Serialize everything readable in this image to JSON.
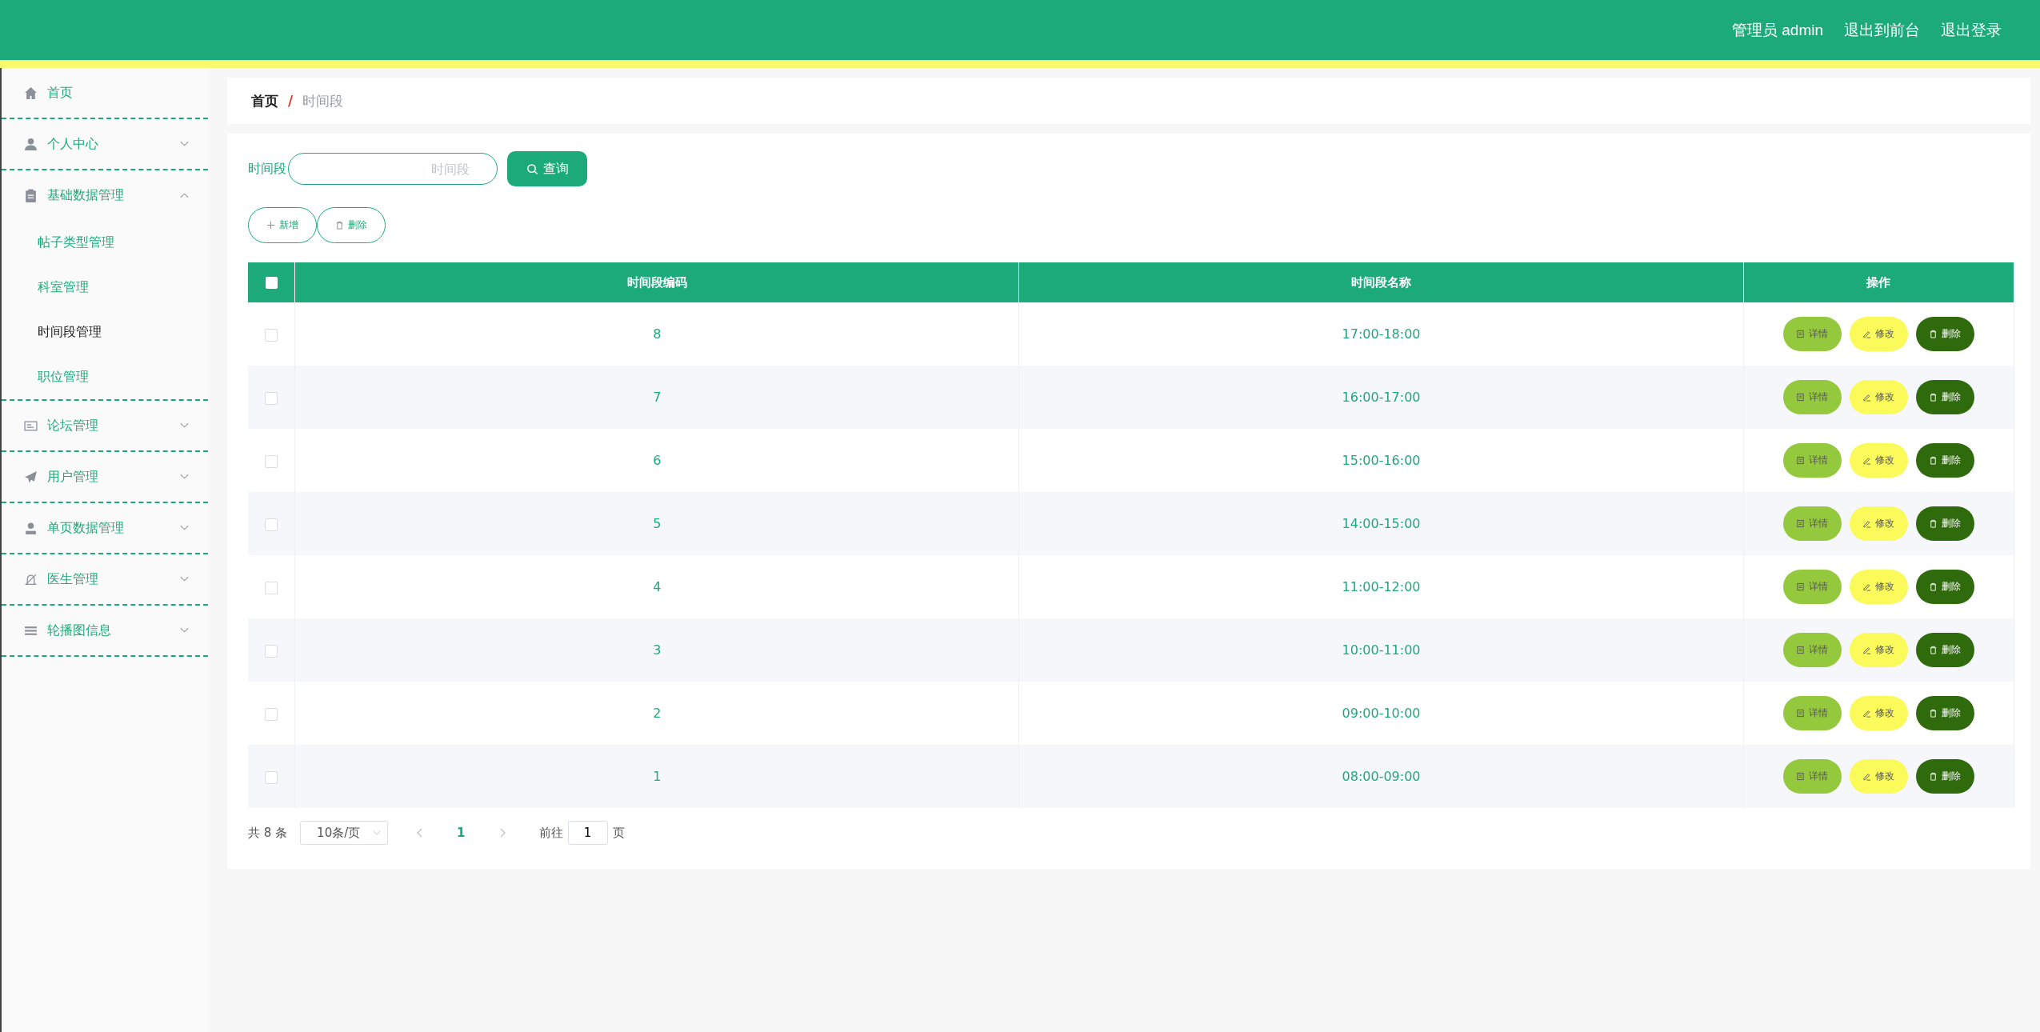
{
  "header": {
    "user_links": [
      "管理员 admin",
      "退出到前台",
      "退出登录"
    ]
  },
  "sidebar": {
    "items": [
      {
        "label": "首页",
        "kind": "link"
      },
      {
        "label": "个人中心",
        "kind": "menu",
        "expanded": false
      },
      {
        "label": "基础数据管理",
        "kind": "menu",
        "expanded": true,
        "children": [
          {
            "label": "帖子类型管理",
            "selected": false
          },
          {
            "label": "科室管理",
            "selected": false
          },
          {
            "label": "时间段管理",
            "selected": true
          },
          {
            "label": "职位管理",
            "selected": false
          }
        ]
      },
      {
        "label": "论坛管理",
        "kind": "menu",
        "expanded": false
      },
      {
        "label": "用户管理",
        "kind": "menu",
        "expanded": false
      },
      {
        "label": "单页数据管理",
        "kind": "menu",
        "expanded": false
      },
      {
        "label": "医生管理",
        "kind": "menu",
        "expanded": false
      },
      {
        "label": "轮播图信息",
        "kind": "menu",
        "expanded": false
      }
    ]
  },
  "breadcrumb": {
    "home": "首页",
    "separator": "/",
    "current": "时间段"
  },
  "search": {
    "label": "时间段",
    "placeholder": "时间段",
    "button": "查询"
  },
  "toolbar": [
    {
      "label": "新增",
      "kind": "add"
    },
    {
      "label": "删除",
      "kind": "delete"
    }
  ],
  "table": {
    "select_all_checked": false,
    "columns": [
      "时间段编码",
      "时间段名称",
      "操作"
    ],
    "rows": [
      {
        "checked": false,
        "code": "8",
        "name": "17:00-18:00",
        "actions": [
          {
            "label": "详情",
            "kind": "detail"
          },
          {
            "label": "修改",
            "kind": "edit"
          },
          {
            "label": "删除",
            "kind": "delete"
          }
        ]
      },
      {
        "checked": false,
        "code": "7",
        "name": "16:00-17:00",
        "actions": [
          {
            "label": "详情",
            "kind": "detail"
          },
          {
            "label": "修改",
            "kind": "edit"
          },
          {
            "label": "删除",
            "kind": "delete"
          }
        ]
      },
      {
        "checked": false,
        "code": "6",
        "name": "15:00-16:00",
        "actions": [
          {
            "label": "详情",
            "kind": "detail"
          },
          {
            "label": "修改",
            "kind": "edit"
          },
          {
            "label": "删除",
            "kind": "delete"
          }
        ]
      },
      {
        "checked": false,
        "code": "5",
        "name": "14:00-15:00",
        "actions": [
          {
            "label": "详情",
            "kind": "detail"
          },
          {
            "label": "修改",
            "kind": "edit"
          },
          {
            "label": "删除",
            "kind": "delete"
          }
        ]
      },
      {
        "checked": false,
        "code": "4",
        "name": "11:00-12:00",
        "actions": [
          {
            "label": "详情",
            "kind": "detail"
          },
          {
            "label": "修改",
            "kind": "edit"
          },
          {
            "label": "删除",
            "kind": "delete"
          }
        ]
      },
      {
        "checked": false,
        "code": "3",
        "name": "10:00-11:00",
        "actions": [
          {
            "label": "详情",
            "kind": "detail"
          },
          {
            "label": "修改",
            "kind": "edit"
          },
          {
            "label": "删除",
            "kind": "delete"
          }
        ]
      },
      {
        "checked": false,
        "code": "2",
        "name": "09:00-10:00",
        "actions": [
          {
            "label": "详情",
            "kind": "detail"
          },
          {
            "label": "修改",
            "kind": "edit"
          },
          {
            "label": "删除",
            "kind": "delete"
          }
        ]
      },
      {
        "checked": false,
        "code": "1",
        "name": "08:00-09:00",
        "actions": [
          {
            "label": "详情",
            "kind": "detail"
          },
          {
            "label": "修改",
            "kind": "edit"
          },
          {
            "label": "删除",
            "kind": "delete"
          }
        ]
      }
    ]
  },
  "pagination": {
    "total": "共 8 条",
    "page_size": "10条/页",
    "pages": [
      {
        "label": "1",
        "selected": true
      }
    ],
    "goto_label": "前往",
    "goto_value": "1",
    "goto_suffix": "页"
  }
}
